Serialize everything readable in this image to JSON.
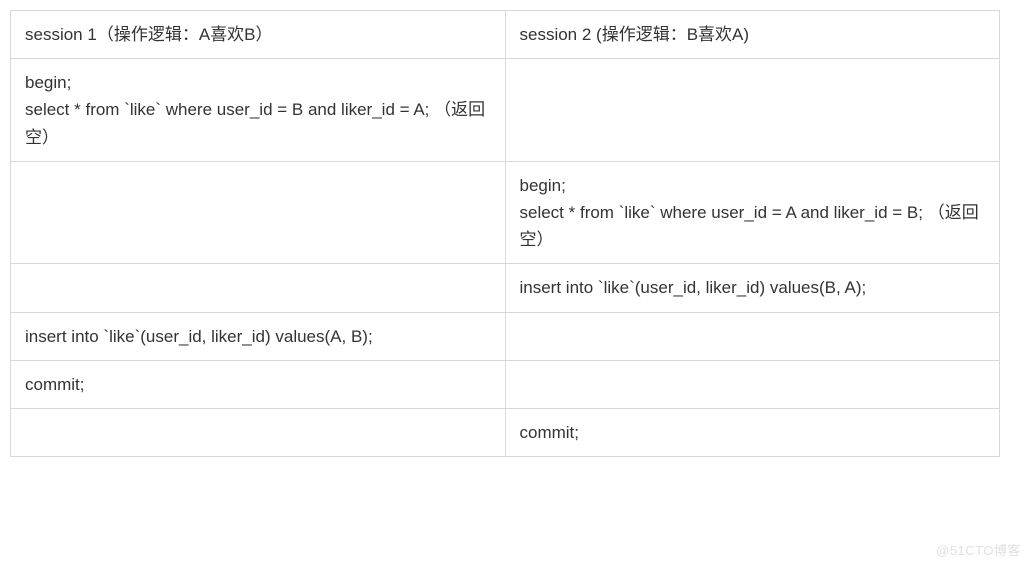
{
  "table": {
    "headers": [
      "session 1（操作逻辑：A喜欢B）",
      "session 2 (操作逻辑：B喜欢A)"
    ],
    "rows": [
      [
        "begin;\nselect * from `like` where user_id = B and liker_id = A; （返回空）",
        ""
      ],
      [
        "",
        "begin;\nselect * from `like` where user_id = A and liker_id = B; （返回空）"
      ],
      [
        "",
        "insert into `like`(user_id, liker_id) values(B, A);"
      ],
      [
        "insert into `like`(user_id, liker_id) values(A, B);",
        ""
      ],
      [
        "commit;",
        ""
      ],
      [
        "",
        "commit;"
      ]
    ]
  },
  "watermark": "@51CTO博客"
}
